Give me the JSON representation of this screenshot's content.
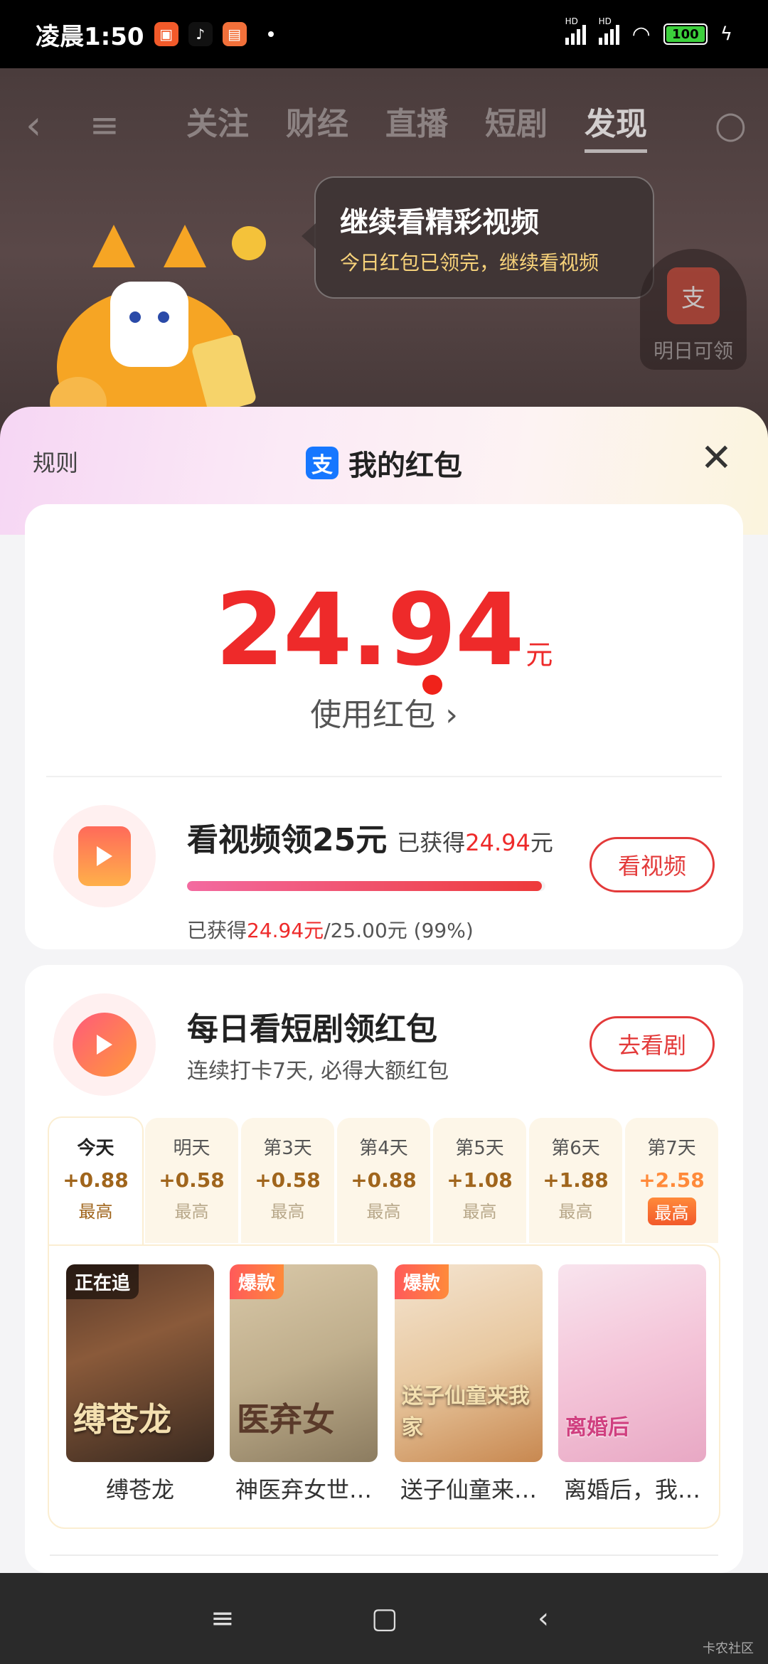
{
  "status_bar": {
    "time": "凌晨1:50",
    "battery": "100",
    "hd1": "HD",
    "hd2": "HD"
  },
  "background_app": {
    "tabs": [
      "关注",
      "财经",
      "直播",
      "短剧",
      "发现"
    ],
    "active_tab": "发现",
    "bubble_title": "继续看精彩视频",
    "bubble_sub": "今日红包已领完，继续看视频",
    "tomorrow_label": "明日可领",
    "tomorrow_icon_char": "支"
  },
  "sheet": {
    "rules_label": "规则",
    "title": "我的红包",
    "logo_char": "支",
    "amount": "24.94",
    "amount_unit": "元",
    "use_label": "使用红包"
  },
  "video_task": {
    "title": "看视频领25元",
    "earned_prefix": "已获得",
    "earned_value": "24.94",
    "earned_unit": "元",
    "progress": 0.99,
    "sub_prefix": "已获得",
    "sub_value": "24.94元",
    "sub_rest": "/25.00元 (99%)",
    "button": "看视频"
  },
  "drama_task": {
    "title": "每日看短剧领红包",
    "subtitle": "连续打卡7天, 必得大额红包",
    "button": "去看剧",
    "days": [
      {
        "day": "今天",
        "value": "+0.88",
        "hint": "最高"
      },
      {
        "day": "明天",
        "value": "+0.58",
        "hint": "最高"
      },
      {
        "day": "第3天",
        "value": "+0.58",
        "hint": "最高"
      },
      {
        "day": "第4天",
        "value": "+0.88",
        "hint": "最高"
      },
      {
        "day": "第5天",
        "value": "+1.08",
        "hint": "最高"
      },
      {
        "day": "第6天",
        "value": "+1.88",
        "hint": "最高"
      },
      {
        "day": "第7天",
        "value": "+2.58",
        "hint": "最高"
      }
    ],
    "dramas": [
      {
        "name": "缚苍龙",
        "tag": "正在追",
        "poster_text": "缚苍龙"
      },
      {
        "name": "神医弃女世…",
        "tag": "爆款",
        "poster_text": "医弃女"
      },
      {
        "name": "送子仙童来…",
        "tag": "爆款",
        "poster_text": "送子仙童来我家"
      },
      {
        "name": "离婚后，我…",
        "tag": "",
        "poster_text": "离婚后"
      }
    ]
  },
  "watermark": "卡农社区",
  "colors": {
    "accent_red": "#ee2a2a",
    "alipay_blue": "#1677ff"
  }
}
